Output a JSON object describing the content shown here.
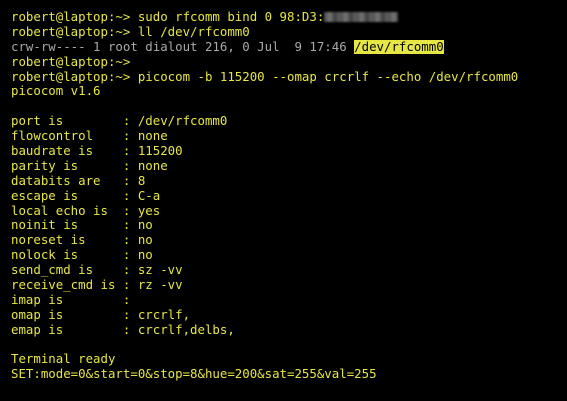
{
  "terminal": {
    "colors": {
      "background": "#000000",
      "text": "#e6e645",
      "dim_text": "#a9a9a9",
      "highlight_bg": "#e6e645"
    },
    "lines": [
      "robert@laptop:~> sudo rfcomm bind 0 98:D3:",
      "robert@laptop:~> ll /dev/rfcomm0",
      "crw-rw---- 1 root dialout 216, 0 Jul  9 17:46 ",
      "/dev/rfcomm0",
      "robert@laptop:~>",
      "robert@laptop:~> picocom -b 115200 --omap crcrlf --echo /dev/rfcomm0",
      "picocom v1.6",
      "",
      "port is        : /dev/rfcomm0",
      "flowcontrol    : none",
      "baudrate is    : 115200",
      "parity is      : none",
      "databits are   : 8",
      "escape is      : C-a",
      "local echo is  : yes",
      "noinit is      : no",
      "noreset is     : no",
      "nolock is      : no",
      "send_cmd is    : sz -vv",
      "receive_cmd is : rz -vv",
      "imap is        :",
      "omap is        : crcrlf,",
      "emap is        : crcrlf,delbs,",
      "",
      "Terminal ready",
      "SET:mode=0&start=0&stop=8&hue=200&sat=255&val=255"
    ]
  }
}
